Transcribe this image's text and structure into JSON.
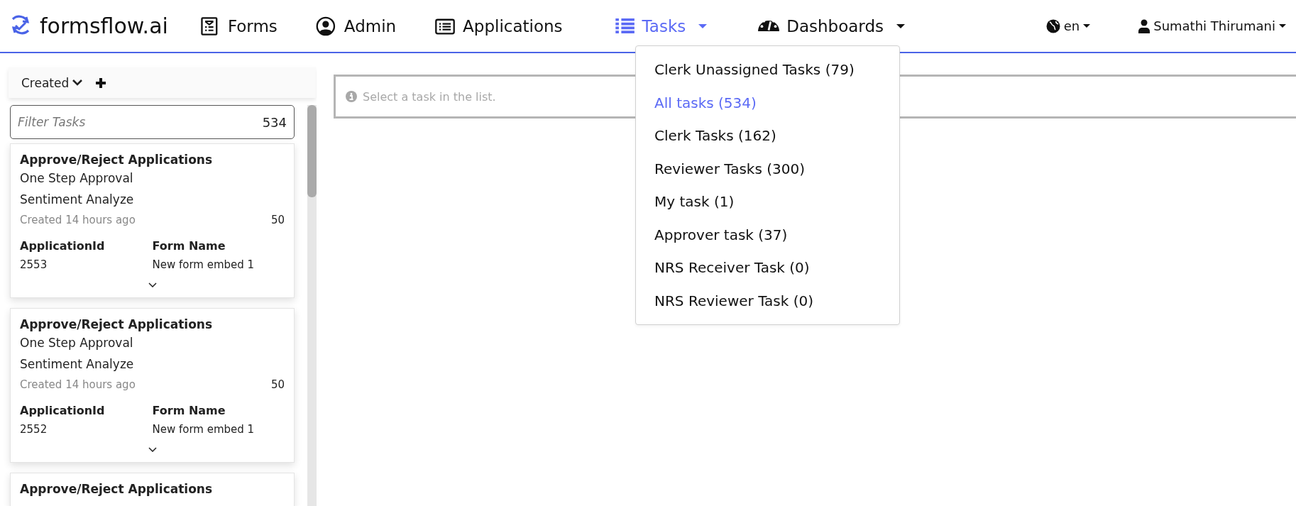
{
  "header": {
    "brand": "formsflow.ai",
    "nav": [
      {
        "kind": "forms",
        "label": "Forms",
        "selected": false,
        "caret": false
      },
      {
        "kind": "admin",
        "label": "Admin",
        "selected": false,
        "caret": false
      },
      {
        "kind": "applications",
        "label": "Applications",
        "selected": false,
        "caret": false
      },
      {
        "kind": "tasks",
        "label": "Tasks",
        "selected": true,
        "caret": true
      },
      {
        "kind": "dashboards",
        "label": "Dashboards",
        "selected": false,
        "caret": true
      }
    ],
    "language": "en",
    "user": "Sumathi Thirumani"
  },
  "task_filter_menu": {
    "items": [
      {
        "label": "Clerk Unassigned Tasks (79)",
        "selected": false
      },
      {
        "label": "All tasks (534)",
        "selected": true
      },
      {
        "label": "Clerk Tasks (162)",
        "selected": false
      },
      {
        "label": "Reviewer Tasks (300)",
        "selected": false
      },
      {
        "label": "My task (1)",
        "selected": false
      },
      {
        "label": "Approver task (37)",
        "selected": false
      },
      {
        "label": "NRS Receiver Task (0)",
        "selected": false
      },
      {
        "label": "NRS Reviewer Task (0)",
        "selected": false
      }
    ]
  },
  "sidebar": {
    "sort": "Created",
    "filter": {
      "placeholder": "Filter Tasks",
      "count": "534"
    },
    "tasks": [
      {
        "title": "Approve/Reject Applications",
        "process": "One Step Approval",
        "assignee_group": "Sentiment Analyze",
        "created": "Created 14 hours ago",
        "priority": "50",
        "fields": [
          {
            "label": "ApplicationId",
            "value": "2553"
          },
          {
            "label": "Form Name",
            "value": "New form embed 1"
          }
        ]
      },
      {
        "title": "Approve/Reject Applications",
        "process": "One Step Approval",
        "assignee_group": "Sentiment Analyze",
        "created": "Created 14 hours ago",
        "priority": "50",
        "fields": [
          {
            "label": "ApplicationId",
            "value": "2552"
          },
          {
            "label": "Form Name",
            "value": "New form embed 1"
          }
        ]
      },
      {
        "title": "Approve/Reject Applications"
      }
    ]
  },
  "main": {
    "message": "Select a task in the list."
  }
}
